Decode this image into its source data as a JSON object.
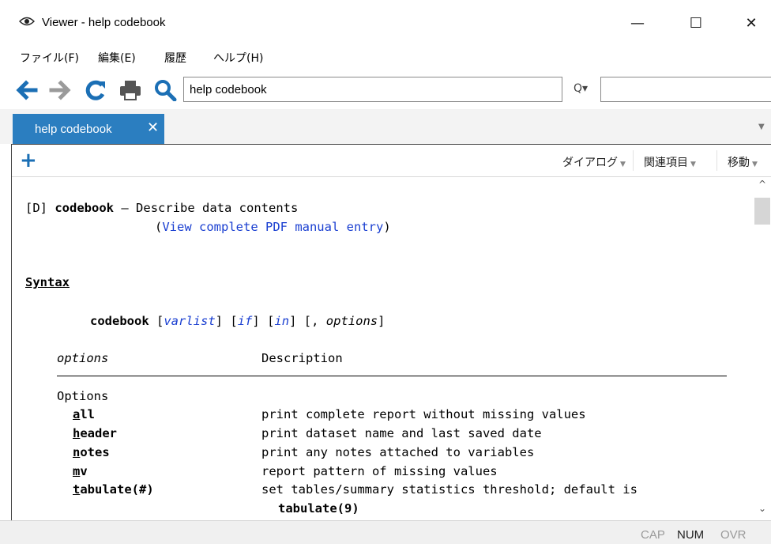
{
  "window": {
    "title": "Viewer - help codebook",
    "minimize_glyph": "—",
    "maximize_glyph": "☐",
    "close_glyph": "✕"
  },
  "menubar": {
    "items": [
      {
        "label": "ファイル(F)"
      },
      {
        "label": "編集(E)"
      },
      {
        "label": "履歴"
      },
      {
        "label": "ヘルプ(H)"
      }
    ]
  },
  "toolbar": {
    "address_value": "help codebook",
    "search_options_glyph": "Q▾",
    "search_value": ""
  },
  "tabs": [
    {
      "label": "help codebook",
      "close_glyph": "✕",
      "active": true
    }
  ],
  "subtoolbar": {
    "add_glyph": "+",
    "dialog_label": "ダイアログ",
    "related_label": "関連項目",
    "goto_label": "移動"
  },
  "help": {
    "header_bracket": "[D]",
    "header_cmd": "codebook",
    "header_dash": "—",
    "header_desc": "Describe data contents",
    "pdf_open": "(",
    "pdf_link": "View complete PDF manual entry",
    "pdf_close": ")",
    "syntax_heading": "Syntax",
    "syntax_cmd": "codebook",
    "syntax_open1": "[",
    "syntax_varlist": "varlist",
    "syntax_close1": "]",
    "syntax_open2": "[",
    "syntax_if": "if",
    "syntax_close2": "]",
    "syntax_open3": "[",
    "syntax_in": "in",
    "syntax_close3": "]",
    "syntax_comma": "[,",
    "syntax_options": "options",
    "syntax_close4": "]",
    "options_col": "options",
    "description_col": "Description",
    "group_label": "Options",
    "opt1_first": "a",
    "opt1_rest": "ll",
    "opt1_desc": "print complete report without missing values",
    "opt2_first": "h",
    "opt2_rest": "eader",
    "opt2_desc": "print dataset name and last saved date",
    "opt3_first": "n",
    "opt3_rest": "otes",
    "opt3_desc": "print any notes attached to variables",
    "opt4_first": "m",
    "opt4_rest": "v",
    "opt4_desc": "report pattern of missing values",
    "opt5_first": "t",
    "opt5_rest": "abulate(#)",
    "opt5_desc": "set tables/summary statistics threshold; default is",
    "opt5_default": "tabulate(9)"
  },
  "statusbar": {
    "cap": "CAP",
    "num": "NUM",
    "ovr": "OVR"
  },
  "colors": {
    "tab_active": "#2b7ec0",
    "link": "#1a3fd1",
    "toolbar_icon": "#1b6fb5"
  }
}
